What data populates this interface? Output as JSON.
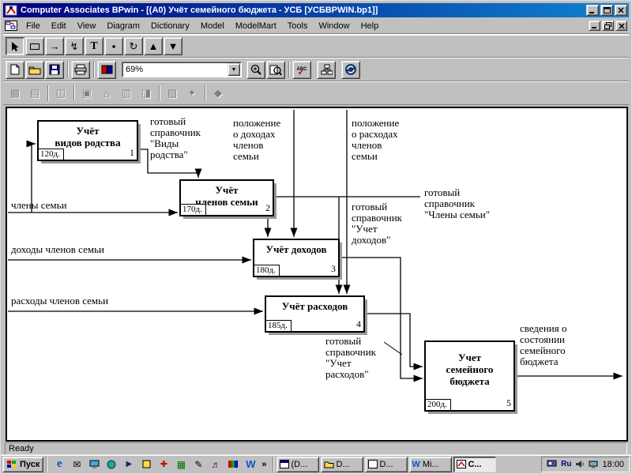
{
  "window": {
    "title": "Computer Associates BPwin - [(A0) Учёт семейного бюджета - УСБ  [УСБBPWIN.bp1]]"
  },
  "menubar": {
    "items": [
      "File",
      "Edit",
      "View",
      "Diagram",
      "Dictionary",
      "Model",
      "ModelMart",
      "Tools",
      "Window",
      "Help"
    ]
  },
  "toolbars": {
    "zoom": {
      "value": "69%"
    },
    "spell_label": "ABC",
    "spell_check": "✓"
  },
  "icons": {
    "arrow_tool": "→",
    "precedence_tool": "↯",
    "text_tool": "T",
    "dot_tool": "▪",
    "rotate_tool": "↻",
    "triangle_up_tool": "▲",
    "triangle_down_tool": "▼",
    "dropdown_arrow": "▼",
    "overflow_chevron": "»",
    "ie": "e",
    "word": "W",
    "mail": "✉",
    "pencil": "✎",
    "plus": "✚",
    "grid": "▦",
    "note": "♬",
    "play": "▶",
    "modelmart": [
      "▦",
      "▤",
      "◫",
      "▣",
      "⌂",
      "▥",
      "◨",
      "▨",
      "✦",
      "◆"
    ]
  },
  "diagram": {
    "boxes": [
      {
        "title": "Учёт\nвидов родства",
        "duration": "120д.",
        "number": "1"
      },
      {
        "title": "Учёт\nчленов семьи",
        "duration": "170д.",
        "number": "2"
      },
      {
        "title": "Учёт доходов",
        "duration": "180д.",
        "number": "3"
      },
      {
        "title": "Учёт расходов",
        "duration": "185д.",
        "number": "4"
      },
      {
        "title": "Учет\nсемейного\nбюджета",
        "duration": "200д.",
        "number": "5"
      }
    ],
    "labels": [
      {
        "text": "готовый\nсправочник\n\"Виды\nродства\""
      },
      {
        "text": "положение\nо доходах\nчленов\nсемьи"
      },
      {
        "text": "положение\nо расходах\nчленов\nсемьи"
      },
      {
        "text": "члены семьи"
      },
      {
        "text": "готовый\nсправочник\n\"Члены семьи\""
      },
      {
        "text": "доходы членов семьи"
      },
      {
        "text": "готовый\nсправочник\n\"Учет\nдоходов\""
      },
      {
        "text": "расходы членов семьи"
      },
      {
        "text": "готовый\nсправочник\n\"Учет\nрасходов\""
      },
      {
        "text": "сведения о\nсостоянии\nсемейного\nбюджета"
      }
    ]
  },
  "statusbar": {
    "text": "Ready"
  },
  "taskbar": {
    "start_label": "Пуск",
    "tasks": [
      {
        "label": "(D...",
        "active": false
      },
      {
        "label": "D...",
        "active": false
      },
      {
        "label": "D...",
        "active": false
      },
      {
        "label": "Mi...",
        "active": false
      },
      {
        "label": "C...",
        "active": true
      }
    ],
    "tray": {
      "language": "Ru",
      "clock": "18:00"
    }
  },
  "colors": {
    "titlebar_start": "#000080",
    "titlebar_end": "#1084d0",
    "chrome": "#c0c0c0",
    "canvas": "#ffffff"
  }
}
